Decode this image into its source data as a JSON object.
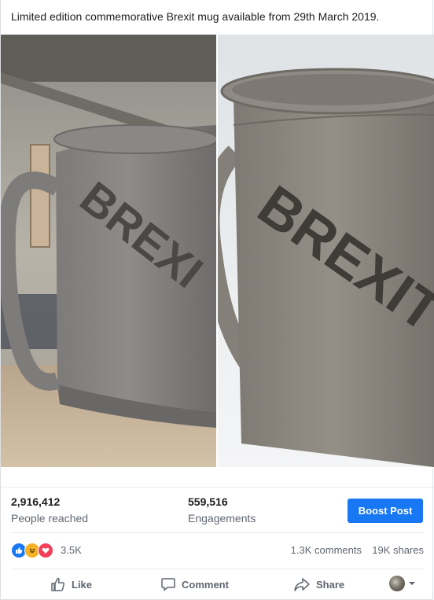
{
  "post": {
    "caption": "Limited edition commemorative Brexit mug available from 29th March 2019."
  },
  "insights": {
    "reached_value": "2,916,412",
    "reached_label": "People reached",
    "engagements_value": "559,516",
    "engagements_label": "Engagements",
    "boost_label": "Boost Post"
  },
  "reactions": {
    "count": "3.5K",
    "comments": "1.3K comments",
    "shares": "19K shares",
    "icons": [
      "like-icon",
      "haha-icon",
      "love-icon"
    ]
  },
  "actions": {
    "like_label": "Like",
    "comment_label": "Comment",
    "share_label": "Share"
  },
  "colors": {
    "accent": "#1877f2",
    "text_secondary": "#606770",
    "love": "#f33e58",
    "haha": "#f7b125"
  }
}
